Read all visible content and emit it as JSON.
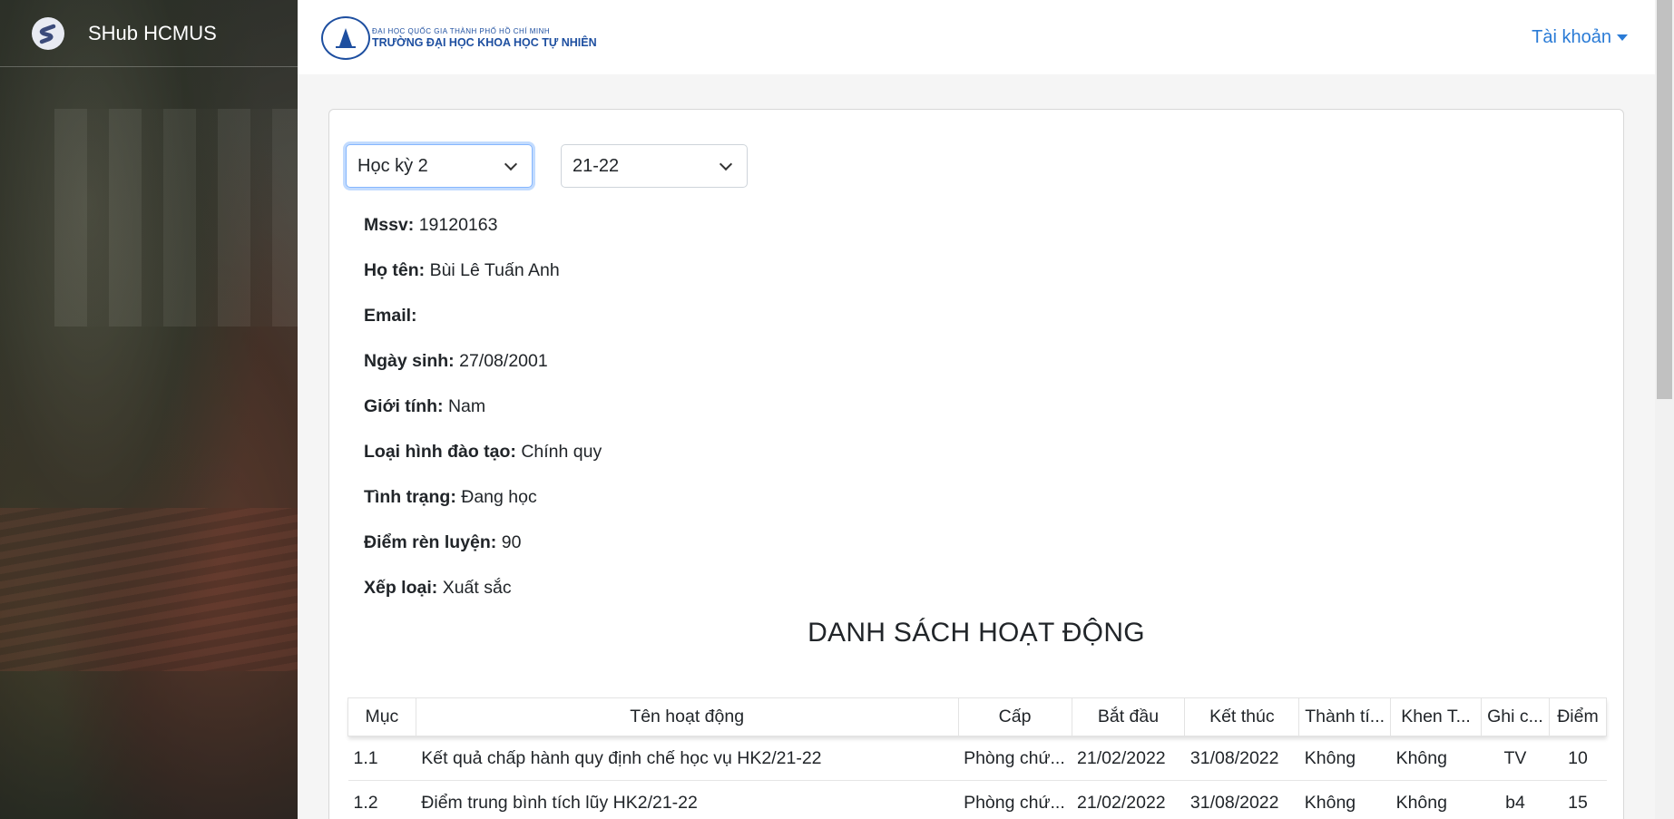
{
  "sidebar": {
    "brand_title": "SHub HCMUS",
    "logo_icon": "shub-logo-icon"
  },
  "header": {
    "university_line1": "ĐẠI HỌC QUỐC GIA THÀNH PHỐ HỒ CHÍ MINH",
    "university_line2": "TRƯỜNG ĐẠI HỌC KHOA HỌC TỰ NHIÊN",
    "account_label": "Tài khoản"
  },
  "filters": {
    "semester": "Học kỳ 2",
    "year": "21-22"
  },
  "student": {
    "mssv_label": "Mssv:",
    "mssv": "19120163",
    "name_label": "Họ tên:",
    "name": "Bùi Lê Tuấn Anh",
    "email_label": "Email:",
    "email": "",
    "dob_label": "Ngày sinh:",
    "dob": "27/08/2001",
    "gender_label": "Giới tính:",
    "gender": "Nam",
    "training_label": "Loại hình đào tạo:",
    "training": "Chính quy",
    "status_label": "Tình trạng:",
    "status": "Đang học",
    "score_label": "Điểm rèn luyện:",
    "score": "90",
    "rank_label": "Xếp loại:",
    "rank": "Xuất sắc"
  },
  "activities": {
    "title": "DANH SÁCH HOẠT ĐỘNG",
    "columns": [
      "Mục",
      "Tên hoạt động",
      "Cấp",
      "Bắt đầu",
      "Kết thúc",
      "Thành tí...",
      "Khen T...",
      "Ghi c...",
      "Điểm"
    ],
    "rows": [
      [
        "1.1",
        "Kết quả chấp hành quy định chế học vụ HK2/21-22",
        "Phòng chứ...",
        "21/02/2022",
        "31/08/2022",
        "Không",
        "Không",
        "TV",
        "10"
      ],
      [
        "1.2",
        "Điểm trung bình tích lũy HK2/21-22",
        "Phòng chứ...",
        "21/02/2022",
        "31/08/2022",
        "Không",
        "Không",
        "b4",
        "15"
      ]
    ]
  },
  "colors": {
    "accent": "#2a7bd6",
    "university_blue": "#1e4fa0"
  }
}
